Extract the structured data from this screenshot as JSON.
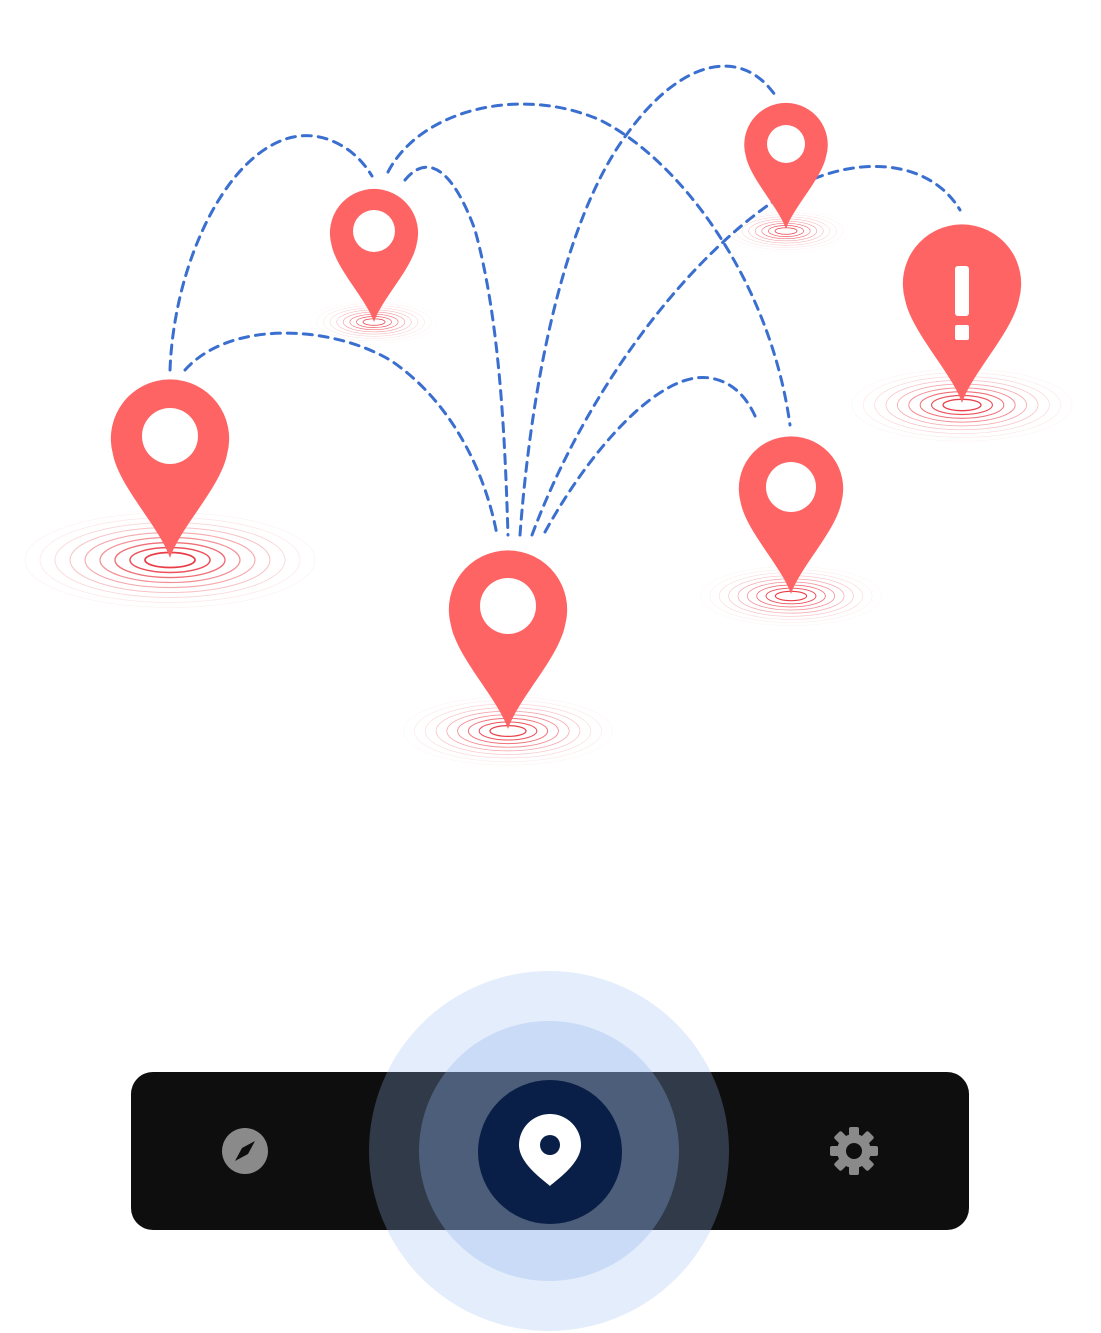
{
  "colors": {
    "pin": "#ff6464",
    "pin_inner": "#ffffff",
    "ripple": "#e8343f",
    "route": "#3a6fd0",
    "nav_background": "#0e0e0e",
    "nav_icon_inactive": "#8a8a8a",
    "nav_icon_active": "#ffffff",
    "active_circle": "#0a1f47",
    "active_halo": "#9db9ee"
  },
  "map": {
    "pins": [
      {
        "id": "pin-left",
        "icon": "map-pin-icon",
        "variant": "dot"
      },
      {
        "id": "pin-upper-left",
        "icon": "map-pin-icon",
        "variant": "dot"
      },
      {
        "id": "pin-center",
        "icon": "map-pin-icon",
        "variant": "dot"
      },
      {
        "id": "pin-top-right",
        "icon": "map-pin-icon",
        "variant": "dot"
      },
      {
        "id": "pin-alert",
        "icon": "alert-pin-icon",
        "variant": "exclamation",
        "symbol": "!"
      },
      {
        "id": "pin-right",
        "icon": "map-pin-icon",
        "variant": "dot"
      }
    ]
  },
  "bottom_nav": {
    "items": [
      {
        "id": "explore",
        "icon": "compass-icon",
        "active": false
      },
      {
        "id": "location",
        "icon": "location-pin-icon",
        "active": true
      },
      {
        "id": "settings",
        "icon": "gear-icon",
        "active": false
      }
    ]
  }
}
